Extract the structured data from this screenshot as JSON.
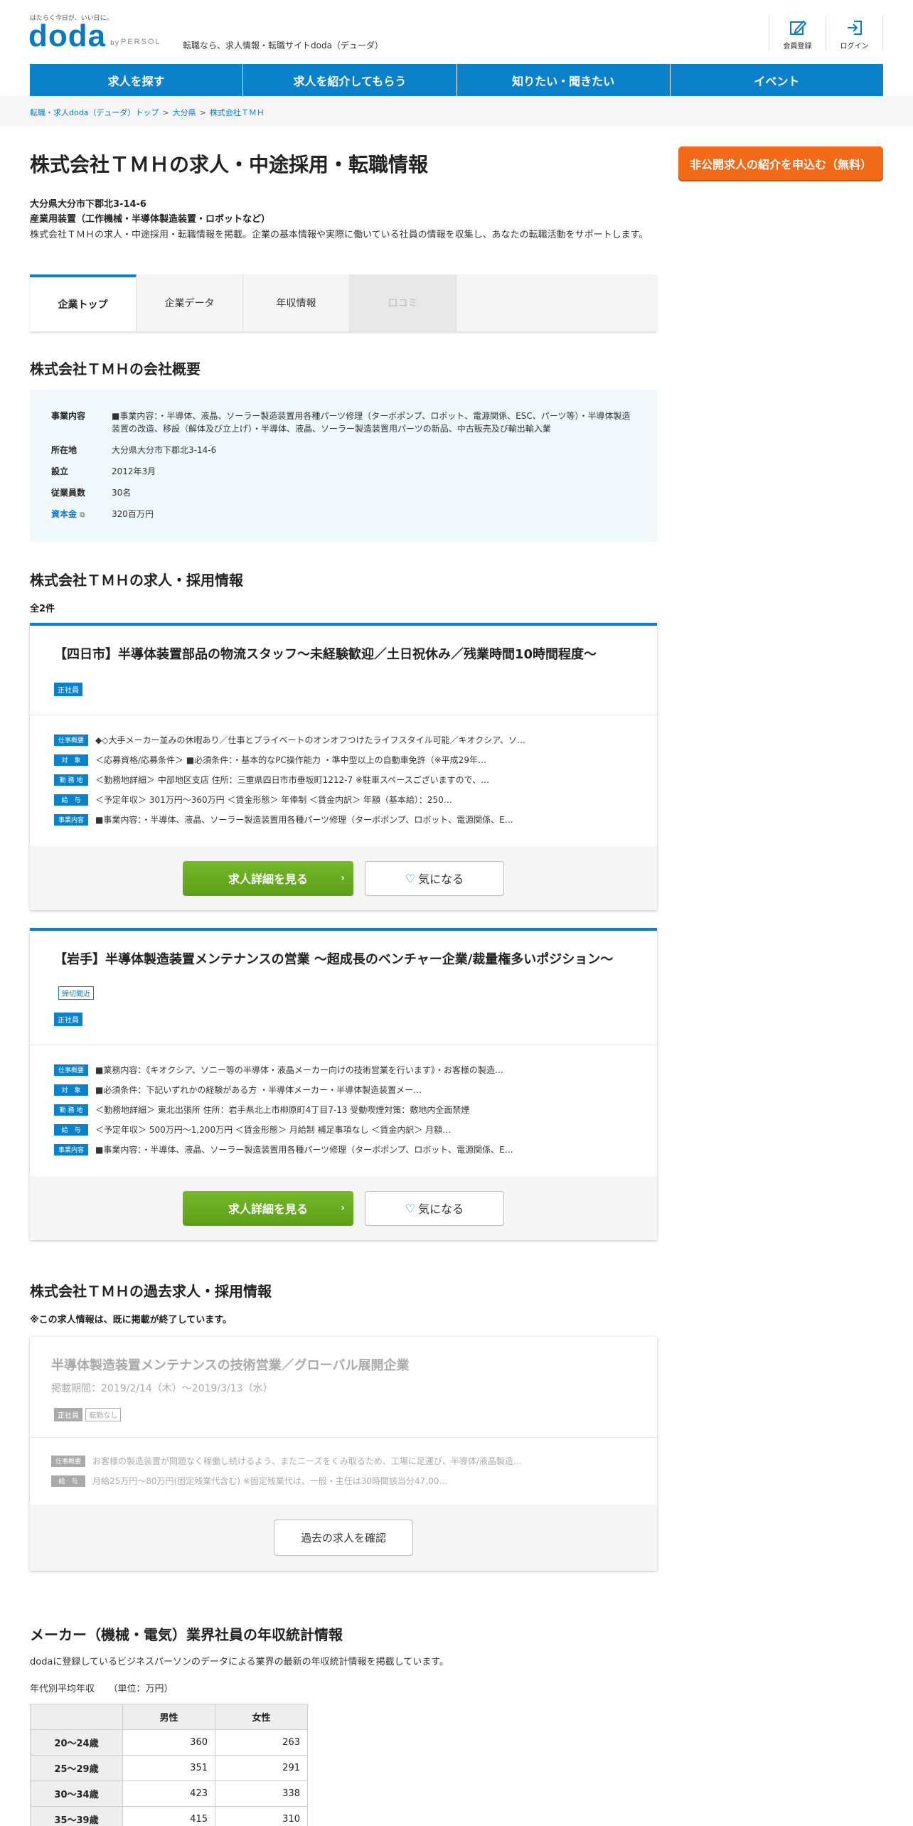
{
  "header": {
    "tagline": "はたらく今日が、いい日に。",
    "logo": "doda",
    "by": "by",
    "persol": "PERSOL",
    "site_desc": "転職なら、求人情報・転職サイトdoda（デューダ）",
    "register_label": "会員登録",
    "login_label": "ログイン"
  },
  "nav": [
    "求人を探す",
    "求人を紹介してもらう",
    "知りたい・聞きたい",
    "イベント"
  ],
  "breadcrumb": [
    "転職・求人doda（デューダ）トップ",
    "大分県",
    "株式会社ＴＭＨ"
  ],
  "breadcrumb_sep": ">",
  "page": {
    "title": "株式会社ＴＭＨの求人・中途採用・転職情報",
    "apply_button": "非公開求人の紹介を申込む（無料）",
    "address": "大分県大分市下郡北3-14-6",
    "industry": "産業用装置（工作機械・半導体製造装置・ロボットなど）",
    "intro": "株式会社ＴＭＨの求人・中途採用・転職情報を掲載。企業の基本情報や実際に働いている社員の情報を収集し、あなたの転職活動をサポートします。"
  },
  "tabs": [
    "企業トップ",
    "企業データ",
    "年収情報",
    "口コミ"
  ],
  "overview": {
    "heading": "株式会社ＴＭＨの会社概要",
    "rows": [
      {
        "key": "事業内容",
        "value": "■事業内容：・半導体、液晶、ソーラー製造装置用各種パーツ修理（ターボポンプ、ロボット、電源関係、ESC、パーツ等）・半導体製造装置の改造、移設（解体及び立上げ）・半導体、液晶、ソーラー製造装置用パーツの新品、中古販売及び輸出輸入業"
      },
      {
        "key": "所在地",
        "value": "大分県大分市下郡北3-14-6"
      },
      {
        "key": "設立",
        "value": "2012年3月"
      },
      {
        "key": "従業員数",
        "value": "30名"
      },
      {
        "key": "資本金",
        "value": "320百万円"
      }
    ]
  },
  "jobs_section": {
    "heading": "株式会社ＴＭＨの求人・採用情報",
    "count": "全2件"
  },
  "jobs": [
    {
      "title": "【四日市】半導体装置部品の物流スタッフ～未経験歓迎／土日祝休み／残業時間10時間程度～",
      "employment": "正社員",
      "info": [
        {
          "label": "仕事概要",
          "text": "◆◇大手メーカー並みの休暇あり／仕事とプライベートのオンオフつけたライフスタイル可能／キオクシア、ソ…"
        },
        {
          "label": "対　象",
          "text": "＜応募資格/応募条件＞ ■必須条件：・基本的なPC操作能力 ・準中型以上の自動車免許（※平成29年…"
        },
        {
          "label": "勤 務 地",
          "text": "＜勤務地詳細＞ 中部地区支店 住所：三重県四日市市垂坂町1212-7 ※駐車スペースございますので、…"
        },
        {
          "label": "給　与",
          "text": "＜予定年収＞ 301万円～360万円 ＜賃金形態＞ 年俸制 ＜賃金内訳＞ 年額（基本給）：250…"
        },
        {
          "label": "事業内容",
          "text": "■事業内容：・半導体、液晶、ソーラー製造装置用各種パーツ修理（ターボポンプ、ロボット、電源関係、E…"
        }
      ],
      "detail_button": "求人詳細を見る",
      "fav_button": "気になる"
    },
    {
      "title": "【岩手】半導体製造装置メンテナンスの営業 ～超成長のベンチャー企業/裁量権多いポジション～",
      "deadline_badge": "締切間近",
      "employment": "正社員",
      "info": [
        {
          "label": "仕事概要",
          "text": "■業務内容：《キオクシア、ソニー等の半導体・液晶メーカー向けの技術営業を行います》・お客様の製造…"
        },
        {
          "label": "対　象",
          "text": "■必須条件：下記いずれかの経験がある方 ・半導体メーカー・半導体製造装置メー…"
        },
        {
          "label": "勤 務 地",
          "text": "＜勤務地詳細＞ 東北出張所 住所：岩手県北上市柳原町4丁目7-13 受動喫煙対策：敷地内全面禁煙"
        },
        {
          "label": "給　与",
          "text": "＜予定年収＞ 500万円～1,200万円 ＜賃金形態＞ 月給制 補足事項なし ＜賃金内訳＞ 月額…"
        },
        {
          "label": "事業内容",
          "text": "■事業内容：・半導体、液晶、ソーラー製造装置用各種パーツ修理（ターボポンプ、ロボット、電源関係、E…"
        }
      ],
      "detail_button": "求人詳細を見る",
      "fav_button": "気になる"
    }
  ],
  "past": {
    "heading": "株式会社ＴＭＨの過去求人・採用情報",
    "note": "※この求人情報は、既に掲載が終了しています。",
    "title": "半導体製造装置メンテナンスの技術営業／グローバル展開企業",
    "period": "掲載期間：2019/2/14（木）～2019/3/13（水）",
    "badge1": "正社員",
    "badge2": "転勤なし",
    "info": [
      {
        "label": "仕事概要",
        "text": "お客様の製造装置が問題なく稼働し続けるよう、またニーズをくみ取るため、工場に足運び、半導体/液晶製造…"
      },
      {
        "label": "給　与",
        "text": "月給25万円～80万円(固定残業代含む) ※固定残業代は、一般・主任は30時間該当分47,00…"
      }
    ],
    "button": "過去の求人を確認"
  },
  "stats": {
    "heading": "メーカー（機械・電気）業界社員の年収統計情報",
    "desc": "dodaに登録しているビジネスパーソンのデータによる業界の最新の年収統計情報を掲載しています。",
    "subtitle": "年代別平均年収　　（単位：万円）",
    "col_male": "男性",
    "col_female": "女性",
    "rows": [
      {
        "age": "20～24歳",
        "male": "360",
        "female": "263"
      },
      {
        "age": "25～29歳",
        "male": "351",
        "female": "291"
      },
      {
        "age": "30～34歳",
        "male": "423",
        "female": "338"
      },
      {
        "age": "35～39歳",
        "male": "415",
        "female": "310"
      }
    ]
  },
  "colors": {
    "brand_blue": "#0b81c9",
    "apply_orange": "#f26a18",
    "detail_green": "#6aad22"
  }
}
